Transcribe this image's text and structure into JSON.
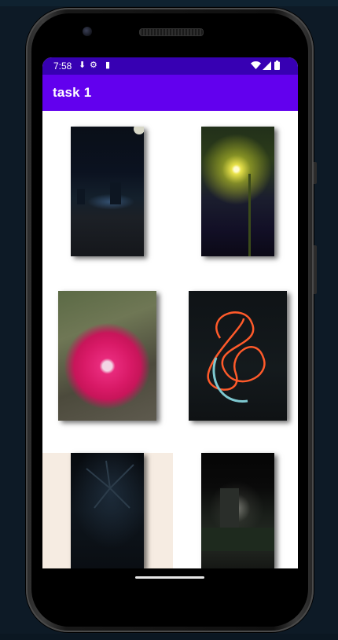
{
  "status_bar": {
    "time": "7:58",
    "left_icons": [
      "download-icon",
      "settings-icon",
      "sd-card-icon"
    ],
    "right_icons": [
      "wifi-icon",
      "signal-icon",
      "battery-icon"
    ]
  },
  "app_bar": {
    "title": "task 1",
    "color": "#6200ee",
    "status_color": "#3700b3"
  },
  "gallery": {
    "images": [
      {
        "subject": "night city skyline"
      },
      {
        "subject": "street lamp in trees at night"
      },
      {
        "subject": "pink dahlia flower"
      },
      {
        "subject": "orange light painting"
      },
      {
        "subject": "palm plant at night"
      },
      {
        "subject": "street at night with buildings"
      }
    ]
  }
}
